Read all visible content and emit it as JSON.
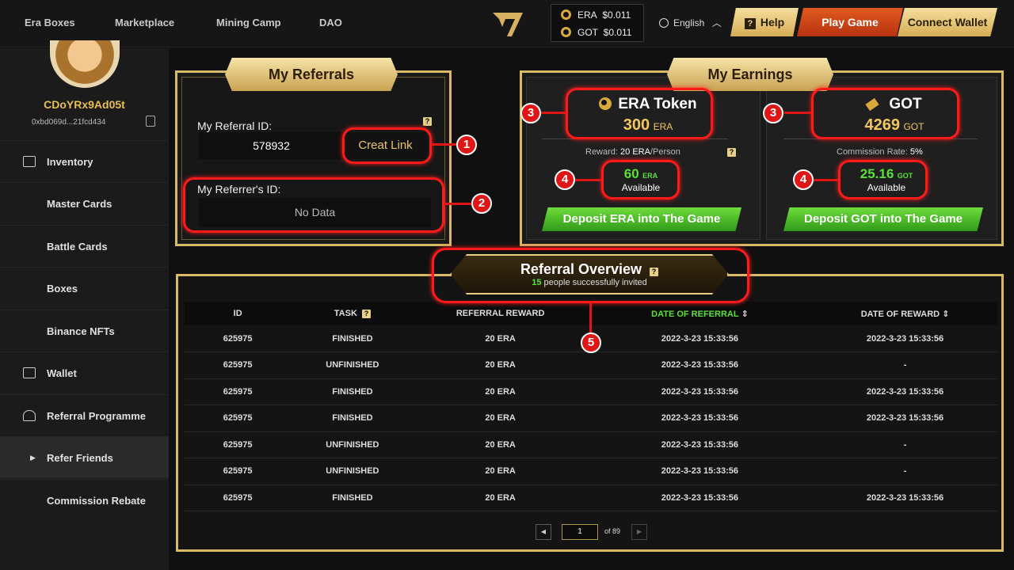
{
  "topnav": {
    "items": [
      "Era Boxes",
      "Marketplace",
      "Mining Camp",
      "DAO"
    ]
  },
  "prices": [
    {
      "token": "ERA",
      "price": "$0.011"
    },
    {
      "token": "GOT",
      "price": "$0.011"
    }
  ],
  "language": "English",
  "buttons": {
    "help": "Help",
    "play": "Play Game",
    "wallet": "Connect Wallet"
  },
  "user": {
    "name": "CDoYRx9Ad05t",
    "address": "0xbd069d...21fcd434"
  },
  "sidebar": {
    "items": [
      "Inventory",
      "Master Cards",
      "Battle Cards",
      "Boxes",
      "Binance NFTs",
      "Wallet",
      "Referral Programme",
      "Refer Friends",
      "Commission Rebate"
    ]
  },
  "referrals": {
    "title": "My Referrals",
    "id_label": "My Referral ID:",
    "id_value": "578932",
    "create_link": "Creat Link",
    "referrer_label": "My Referrer's ID:",
    "referrer_value": "No Data"
  },
  "earnings": {
    "title": "My Earnings",
    "era": {
      "name": "ERA Token",
      "amount": "300",
      "unit": "ERA",
      "info_label": "Reward:",
      "info_value": "20 ERA",
      "info_suffix": "/Person",
      "available": "60",
      "available_unit": "ERA",
      "available_label": "Available",
      "deposit": "Deposit ERA into The Game"
    },
    "got": {
      "name": "GOT",
      "amount": "4269",
      "unit": "GOT",
      "info_label": "Commission Rate:",
      "info_value": "5%",
      "available": "25.16",
      "available_unit": "GOT",
      "available_label": "Available",
      "deposit": "Deposit GOT into The Game"
    }
  },
  "overview": {
    "title": "Referral Overview",
    "count": "15",
    "subtitle": "people successfully invited"
  },
  "table": {
    "headers": [
      "ID",
      "TASK",
      "REFERRAL REWARD",
      "DATE OF REFERRAL",
      "DATE OF REWARD"
    ],
    "rows": [
      [
        "625975",
        "FINISHED",
        "20 ERA",
        "2022-3-23 15:33:56",
        "2022-3-23 15:33:56"
      ],
      [
        "625975",
        "UNFINISHED",
        "20 ERA",
        "2022-3-23 15:33:56",
        "-"
      ],
      [
        "625975",
        "FINISHED",
        "20 ERA",
        "2022-3-23 15:33:56",
        "2022-3-23 15:33:56"
      ],
      [
        "625975",
        "FINISHED",
        "20 ERA",
        "2022-3-23 15:33:56",
        "2022-3-23 15:33:56"
      ],
      [
        "625975",
        "UNFINISHED",
        "20 ERA",
        "2022-3-23 15:33:56",
        "-"
      ],
      [
        "625975",
        "UNFINISHED",
        "20 ERA",
        "2022-3-23 15:33:56",
        "-"
      ],
      [
        "625975",
        "FINISHED",
        "20 ERA",
        "2022-3-23 15:33:56",
        "2022-3-23 15:33:56"
      ]
    ]
  },
  "pagination": {
    "page": "1",
    "of": "of 89"
  },
  "annotations": [
    "1",
    "2",
    "3",
    "3",
    "4",
    "4",
    "5"
  ],
  "colors": {
    "gold": "#d9b866",
    "finished": "#5be03a",
    "unfinished": "#ff3b30",
    "annotation": "#e01515"
  }
}
